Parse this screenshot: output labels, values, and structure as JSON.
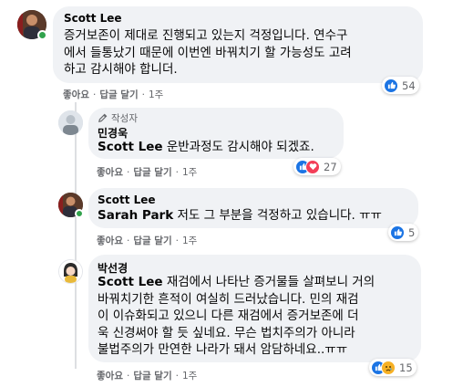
{
  "actions": {
    "like": "좋아요",
    "reply": "답글 달기",
    "time": "1주",
    "separator": "·"
  },
  "comments": [
    {
      "author": "Scott Lee",
      "lines": [
        "증거보존이 제대로 진행되고 있는지 걱정입니다. 연수구",
        "에서 들통났기 때문에 이번엔 바꿔치기 할 가능성도 고려",
        "하고 감시해야 합니더."
      ],
      "reaction_count": "54"
    },
    {
      "author_badge": "작성자",
      "author": "민경욱",
      "mention": "Scott Lee",
      "text": " 운반과정도 감시해야 되겠죠.",
      "reaction_count": "27"
    },
    {
      "author": "Scott Lee",
      "mention": "Sarah Park",
      "text": " 저도 그 부분을 걱정하고 있습니다. ㅠㅠ",
      "reaction_count": "5"
    },
    {
      "author": "박선경",
      "mention": "Scott Lee",
      "line1_rest": " 재검에서 나타난 증거물들 살펴보니 거의",
      "lines": [
        "바꿔치기한 흔적이 여실히 드러났습니다. 민의 재검",
        "이 이슈화되고 있으니 다른 재검에서 증거보존에 더",
        "욱 신경써야 할 듯 싶네요. 무슨 법치주의가 아니라",
        "불법주의가 만연한 나라가 돼서 암담하네요..ㅠㅠ"
      ],
      "reaction_count": "15"
    }
  ]
}
